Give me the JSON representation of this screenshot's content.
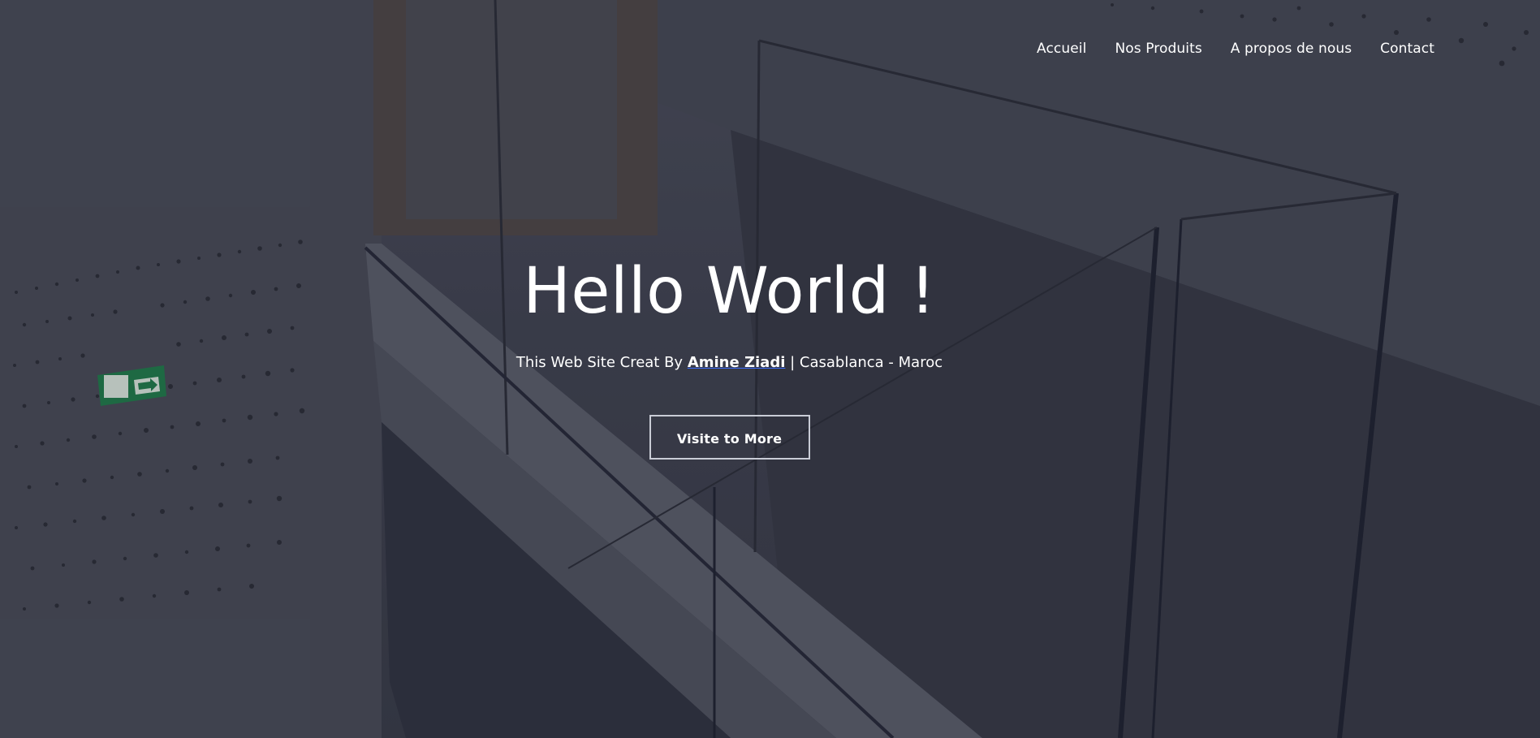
{
  "nav": {
    "items": [
      "Accueil",
      "Nos Produits",
      "A propos de nous",
      "Contact"
    ]
  },
  "hero": {
    "title": "Hello World !",
    "subtitle_prefix": "This Web Site Creat By ",
    "author": "Amine Ziadi",
    "subtitle_suffix": " | Casablanca - Maroc",
    "cta_label": "Visite to More"
  },
  "colors": {
    "text": "#ffffff",
    "background_dark": "#3c3f4b",
    "link_underline": "#3b6cff",
    "exit_sign_green": "#1f7a4a"
  },
  "icons": {
    "exit_sign": "emergency-exit-sign-icon"
  }
}
